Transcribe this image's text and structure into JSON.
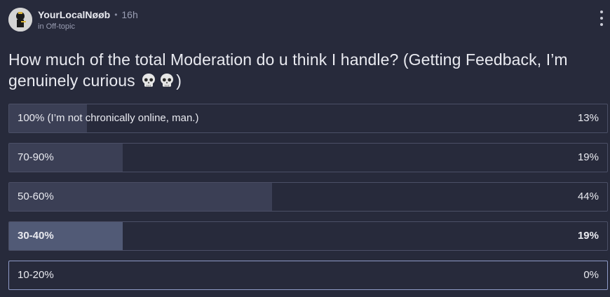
{
  "post": {
    "author": "YourLocalNøøb",
    "separator": "•",
    "time": "16h",
    "category": "in Off-topic",
    "question_text": "How much of the total Moderation do u think I handle? (Getting Feedback, I’m genuinely curious ",
    "question_end": ")",
    "question_emoji": [
      "skull-icon",
      "skull-icon"
    ]
  },
  "poll": {
    "options": [
      {
        "label": "100% (I’m not chronically online, man.)",
        "percent_text": "13%",
        "percent": 13,
        "selected": false,
        "highlight": false
      },
      {
        "label": "70-90%",
        "percent_text": "19%",
        "percent": 19,
        "selected": false,
        "highlight": false
      },
      {
        "label": "50-60%",
        "percent_text": "44%",
        "percent": 44,
        "selected": false,
        "highlight": false
      },
      {
        "label": "30-40%",
        "percent_text": "19%",
        "percent": 19,
        "selected": true,
        "highlight": false
      },
      {
        "label": "10-20%",
        "percent_text": "0%",
        "percent": 0,
        "selected": false,
        "highlight": true
      }
    ]
  },
  "colors": {
    "background": "#272a3b",
    "bar_fill": "#3b3f55",
    "selected_fill": "#515a76",
    "border": "#4b4f66",
    "highlight_border": "#8e9ac7"
  },
  "icons": {
    "avatar": "avatar",
    "menu": "kebab-menu-icon"
  }
}
